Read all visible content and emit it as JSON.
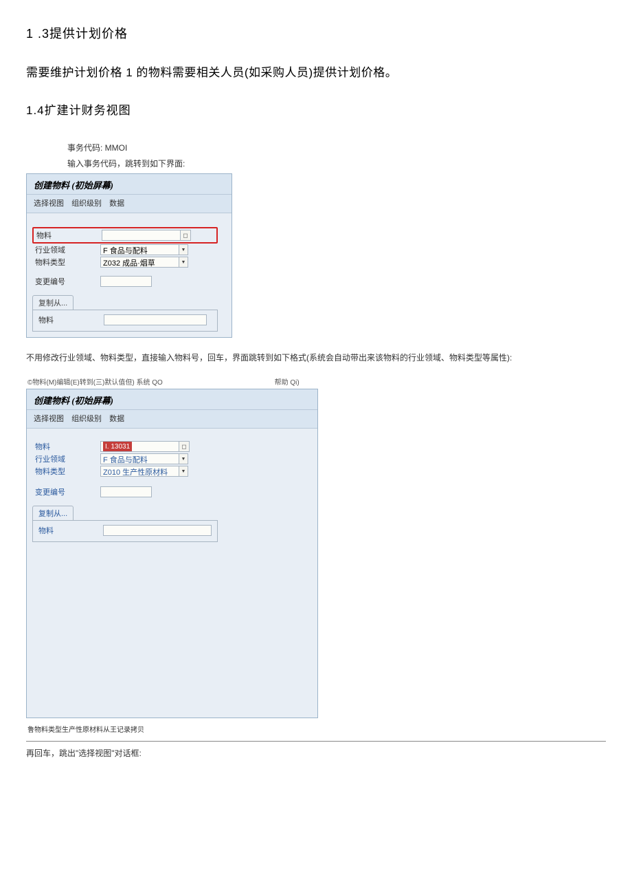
{
  "heading_1_3": "1 .3提供计划价格",
  "para1": "需要维护计划价格 1 的物料需要相关人员(如采购人员)提供计划价格。",
  "heading_1_4": "1.4扩建计财务视图",
  "instruction1": "事务代码: MMOI",
  "instruction2": "输入事务代码，跳转到如下界面:",
  "panel1": {
    "title": "创建物料 (初始屏幕)",
    "toolbar": {
      "select_view": "选择视图",
      "org_level": "组织级别",
      "data": "数据"
    },
    "labels": {
      "material": "物料",
      "industry": "行业领域",
      "type": "物料类型",
      "change_no": "变更编号",
      "copy_from": "复制从...",
      "material2": "物料"
    },
    "values": {
      "industry": "F 食品与配料",
      "type": "Z032 成品·烟草"
    }
  },
  "note_below_1": "不用修改行业领域、物料类型，直接输入物料号，回车，界面跳转到如下格式(系统会自动带出来该物料的行业领域、物料类型等属性):",
  "menubar": {
    "material": "©物料(M)",
    "edit": "编辑(E)",
    "goto": "转到(三)",
    "defaults": "默认值但)",
    "system": "系统",
    "qo": "QO",
    "help": "帮助",
    "qi": "Qi)"
  },
  "panel2": {
    "title": "创建物料 (初始屏幕)",
    "toolbar": {
      "select_view": "选择视图",
      "org_level": "组织级别",
      "data": "数据"
    },
    "labels": {
      "material": "物料",
      "industry": "行业领域",
      "type": "物料类型",
      "change_no": "变更编号",
      "copy_from": "复制从...",
      "material2": "物料"
    },
    "values": {
      "material": "I. 13031",
      "industry": "F 食品与配料",
      "type": "Z010 生产性原材料"
    }
  },
  "bottom_status": "鲁物料类型生产性原材料从王记录拷贝",
  "final_note": "再回车，跳出\"选择视图\"对话框:"
}
